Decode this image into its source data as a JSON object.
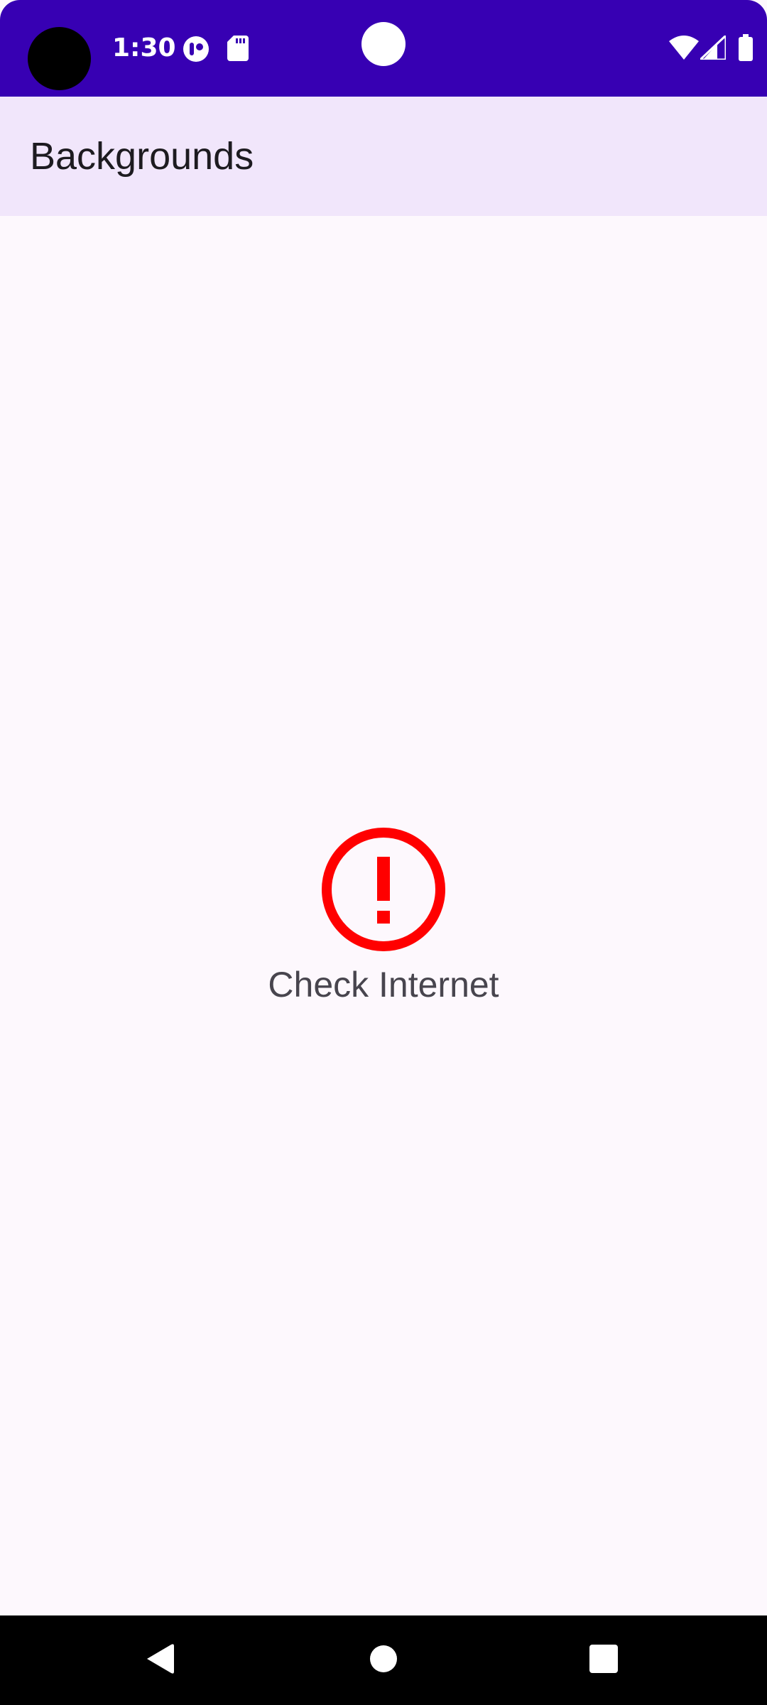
{
  "status_bar": {
    "time": "1:30",
    "background": "#3700b3",
    "icons": [
      "notification-app-icon",
      "sd-card-icon",
      "wifi-icon",
      "cell-signal-icon",
      "battery-icon"
    ]
  },
  "app_bar": {
    "title": "Backgrounds",
    "background": "#f1e6fb"
  },
  "main": {
    "error_icon": "error-circle-icon",
    "error_color": "#ff0000",
    "message": "Check Internet"
  },
  "nav_bar": {
    "buttons": [
      "back-icon",
      "home-icon",
      "recents-icon"
    ]
  }
}
